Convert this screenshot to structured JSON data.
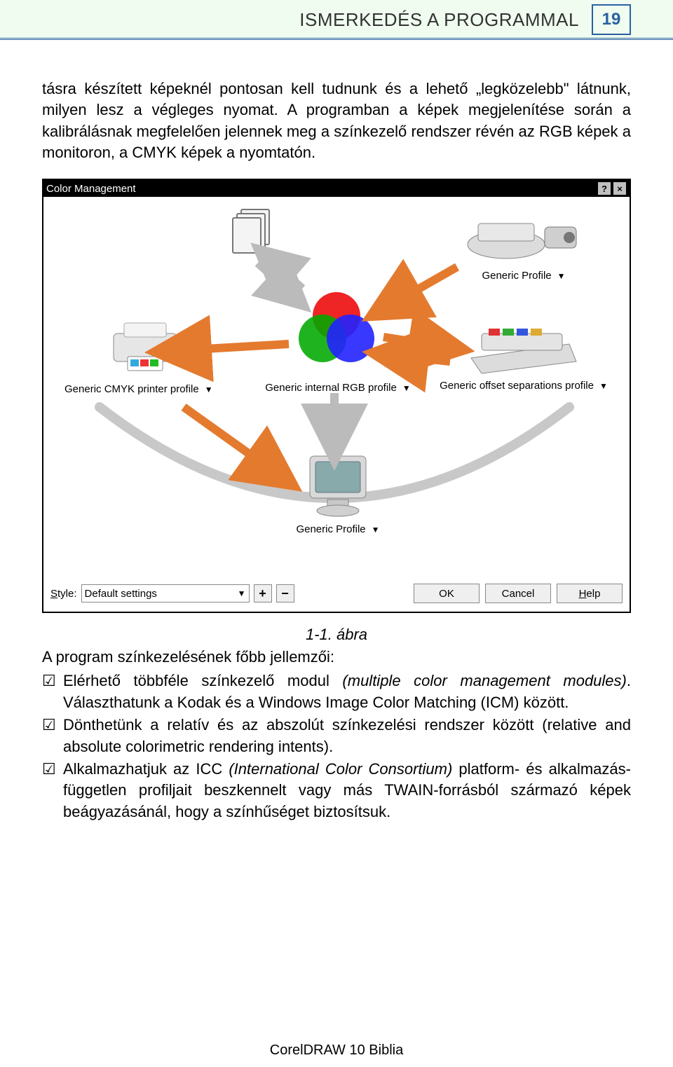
{
  "header": {
    "chapter": "ISMERKEDÉS A PROGRAMMAL",
    "page_number": "19"
  },
  "paragraph1": "tásra készített képeknél pontosan kell tudnunk és a lehető „legköze­lebb\" látnunk, milyen lesz a végleges nyomat. A programban a ké­pek megjelenítése során a kalibrálásnak megfelelően jelennek meg a színkezelő rendszer révén az RGB képek a monitoron, a CMYK képek a nyomtatón.",
  "dialog": {
    "title": "Color Management",
    "help_btn": "?",
    "close_btn": "×",
    "labels": {
      "scanner": "Generic Profile",
      "center": "Generic internal RGB profile",
      "printer": "Generic CMYK printer profile",
      "press": "Generic offset separations profile",
      "monitor": "Generic Profile"
    },
    "style_label": "Style:",
    "style_value": "Default settings",
    "plus": "+",
    "minus": "−",
    "ok": "OK",
    "cancel": "Cancel",
    "help": "Help"
  },
  "caption": "1-1. ábra",
  "intro": "A program színkezelésének főbb jellemzői:",
  "bullets": {
    "b1a": "Elérhető többféle színkezelő modul ",
    "b1b": "(multiple color management modules)",
    "b1c": ". Választhatunk a Kodak és a Windows Image Color Matching (ICM) között.",
    "b2": "Dönthetünk a relatív és az abszolút színkezelési rendszer között (relative and absolute colorimetric rendering intents).",
    "b3a": "Alkalmazhatjuk az ICC ",
    "b3b": "(International Color Consortium)",
    "b3c": " platform- és alkalmazás-független profiljait beszkennelt vagy más TWAIN-forrásból származó képek beágyazásánál, hogy a színhűséget biztosítsuk."
  },
  "footer": "CorelDRAW 10 Biblia"
}
